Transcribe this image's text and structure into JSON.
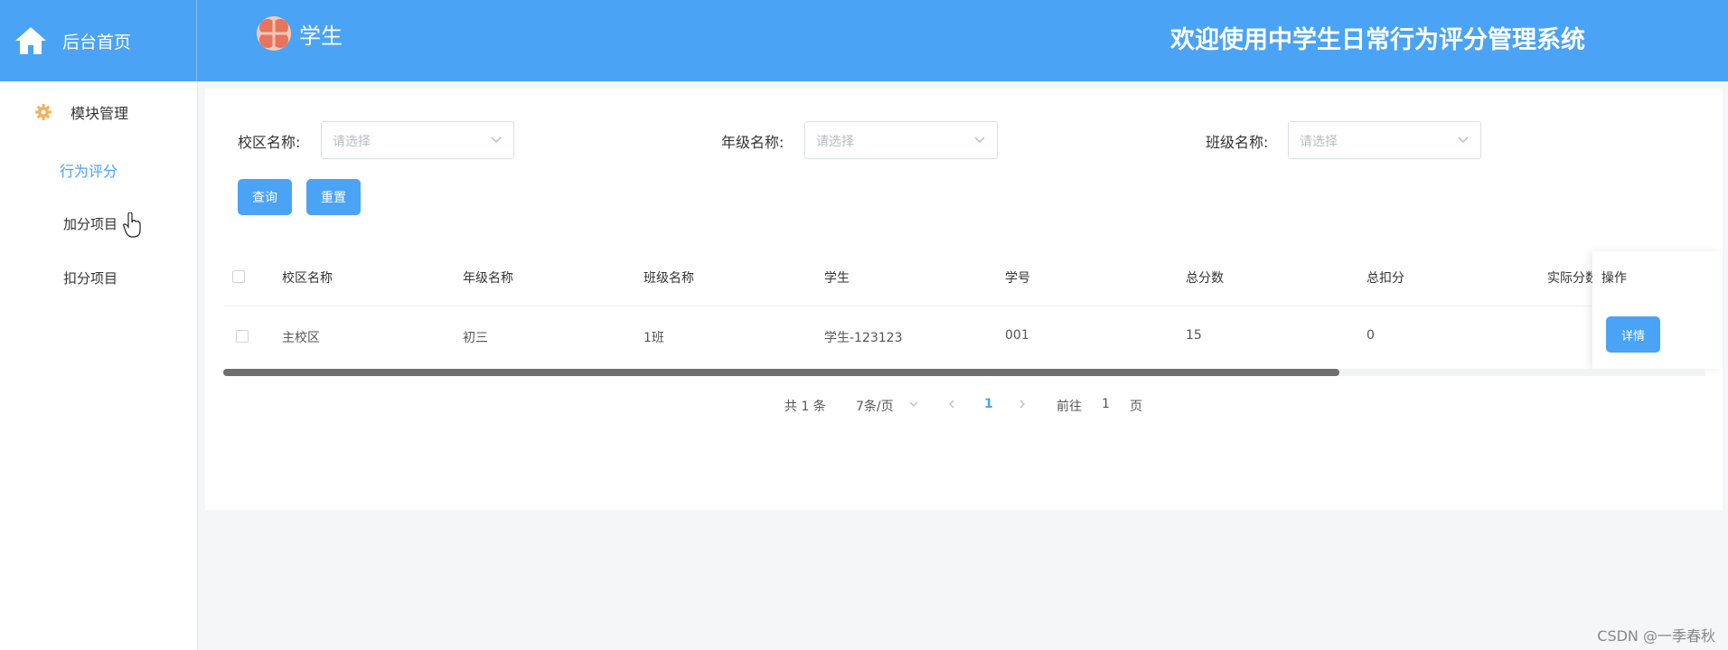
{
  "header": {
    "brand_label": "后台首页",
    "user_name": "学生",
    "welcome": "欢迎使用中学生日常行为评分管理系统"
  },
  "sidebar": {
    "menu_title": "模块管理",
    "items": [
      {
        "label": "行为评分",
        "active": true
      },
      {
        "label": "加分项目",
        "active": false
      },
      {
        "label": "扣分项目",
        "active": false
      }
    ]
  },
  "filters": [
    {
      "label": "校区名称:",
      "placeholder": "请选择"
    },
    {
      "label": "年级名称:",
      "placeholder": "请选择"
    },
    {
      "label": "班级名称:",
      "placeholder": "请选择"
    }
  ],
  "buttons": {
    "query": "查询",
    "reset": "重置"
  },
  "table": {
    "columns": [
      "校区名称",
      "年级名称",
      "班级名称",
      "学生",
      "学号",
      "总分数",
      "总扣分",
      "实际分数",
      "操作"
    ],
    "rows": [
      {
        "campus": "主校区",
        "grade": "初三",
        "class": "1班",
        "student": "学生-123123",
        "student_no": "001",
        "total_score": "15",
        "total_deduct": "0",
        "action": "详情"
      }
    ]
  },
  "pagination": {
    "total": "共 1 条",
    "page_size": "7条/页",
    "current_page": "1",
    "goto_prefix": "前往",
    "goto_value": "1",
    "goto_suffix": "页"
  },
  "watermark": "CSDN @一季春秋",
  "colors": {
    "primary": "#4aa3f5",
    "background": "#f5f6f8"
  }
}
